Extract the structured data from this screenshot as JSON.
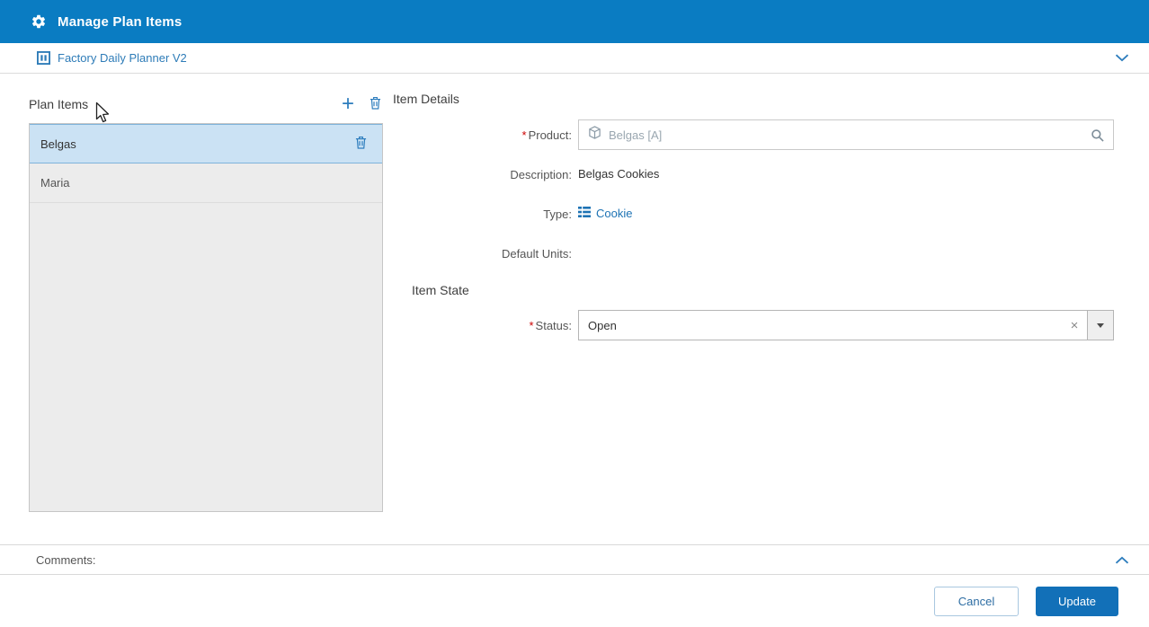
{
  "header": {
    "title": "Manage Plan Items"
  },
  "subheader": {
    "planner": "Factory Daily Planner V2"
  },
  "plan_items": {
    "title": "Plan Items",
    "items": [
      {
        "name": "Belgas",
        "selected": true
      },
      {
        "name": "Maria",
        "selected": false
      }
    ]
  },
  "item_details": {
    "title": "Item Details",
    "required_marker": "*",
    "product": {
      "label": "Product:",
      "value": "Belgas [A]"
    },
    "description": {
      "label": "Description:",
      "value": "Belgas Cookies"
    },
    "type": {
      "label": "Type:",
      "value": "Cookie"
    },
    "default_units": {
      "label": "Default Units:",
      "value": ""
    },
    "item_state_title": "Item State",
    "status": {
      "label": "Status:",
      "value": "Open"
    }
  },
  "comments": {
    "label": "Comments:"
  },
  "footer": {
    "cancel_label": "Cancel",
    "update_label": "Update"
  },
  "icons": {
    "add": "+",
    "clear": "×",
    "gear": "gear-icon",
    "planner": "grid-table-icon",
    "delete": "trash-icon",
    "product": "cube-icon",
    "search": "magnifier-icon",
    "type": "list-grid-icon",
    "dropdown": "triangle-down",
    "collapse": "chevron-up",
    "expand": "chevron-down"
  },
  "colors": {
    "header_bg": "#0a7cc2",
    "accent_blue": "#2d7dbd",
    "link_blue": "#1e73b4",
    "selected_row_bg": "#cbe2f4",
    "primary_button_bg": "#1270b8",
    "required_red": "#cc0000"
  }
}
